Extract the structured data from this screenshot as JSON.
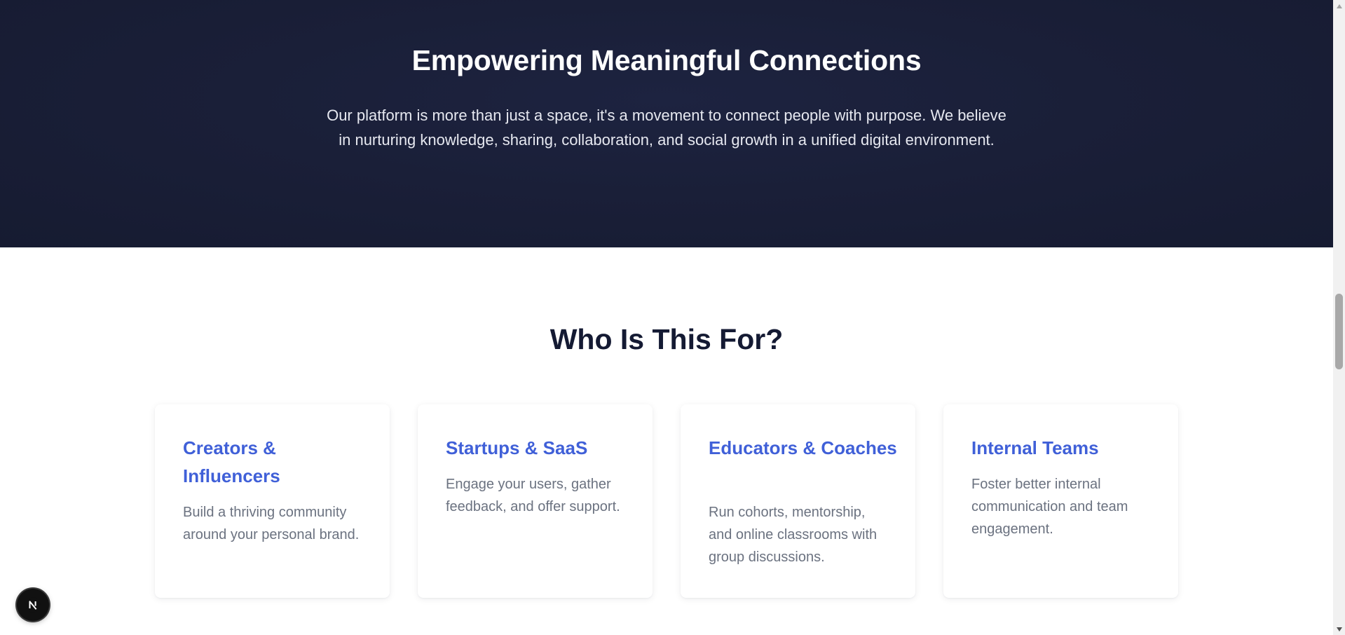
{
  "banner": {
    "title": "Empowering Meaningful Connections",
    "text": "Our platform is more than just a space, it's a movement to connect people with purpose. We believe in nurturing knowledge, sharing, collaboration, and social growth in a unified digital environment."
  },
  "audience": {
    "title": "Who Is This For?",
    "cards": [
      {
        "title": "Creators & Influencers",
        "description": "Build a thriving community around your personal brand."
      },
      {
        "title": "Startups & SaaS",
        "description": "Engage your users, gather feedback, and offer support."
      },
      {
        "title": "Educators & Coaches",
        "description": "Run cohorts, mentorship, and online classrooms with group discussions."
      },
      {
        "title": "Internal Teams",
        "description": "Foster better internal communication and team engagement."
      }
    ]
  },
  "dev_badge": {
    "icon": "nextjs-logo-icon",
    "letter": "N"
  },
  "colors": {
    "banner_bg": "#1a1f38",
    "card_title": "#4060d8",
    "heading_dark": "#141a33",
    "body_gray": "#6b7280"
  }
}
